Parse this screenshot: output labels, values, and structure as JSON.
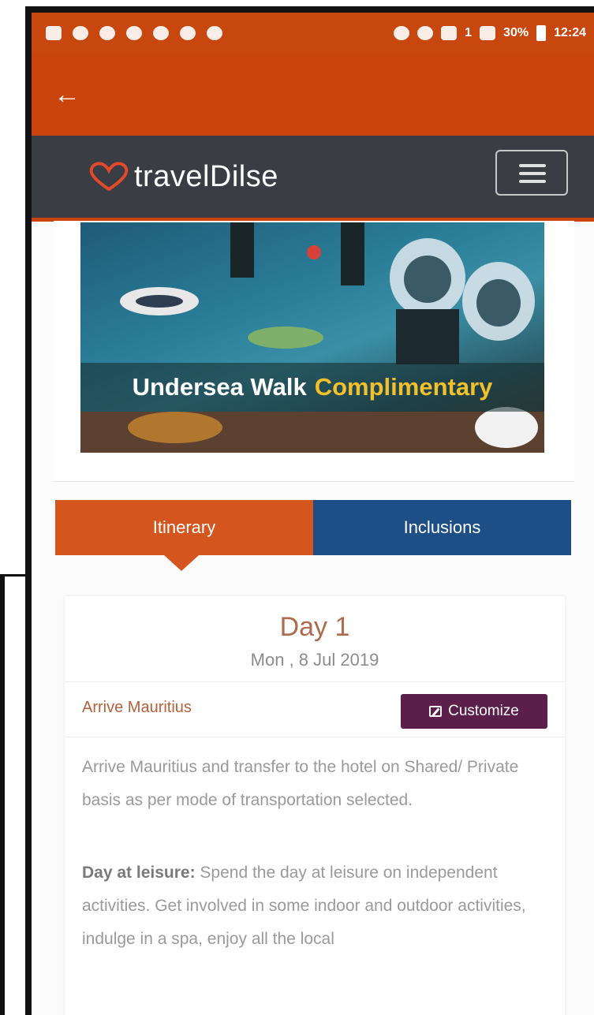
{
  "status_bar": {
    "network_label": "1",
    "battery_percent": "30%",
    "time": "12:24"
  },
  "app_bar": {
    "back_icon": "arrow-left-icon"
  },
  "nav": {
    "brand_name": "travelDilse",
    "menu_icon": "hamburger-menu-icon"
  },
  "banner": {
    "caption_main": "Undersea Walk",
    "caption_highlight": "Complimentary"
  },
  "tabs": [
    {
      "label": "Itinerary",
      "active": true
    },
    {
      "label": "Inclusions",
      "active": false
    }
  ],
  "day": {
    "title": "Day 1",
    "date": "Mon , 8 Jul 2019",
    "activity_title": "Arrive Mauritius",
    "customize_label": "Customize",
    "description_1": "Arrive Mauritius and transfer to the hotel on Shared/ Private basis as per mode of transportation selected.",
    "leisure_label": "Day at leisure:",
    "description_2": " Spend the day at leisure on independent activities. Get involved in some indoor and outdoor activities, indulge in a spa, enjoy all the local"
  },
  "colors": {
    "header_orange": "#c9450d",
    "nav_dark": "#3a3d43",
    "tab_active": "#d4561e",
    "tab_inactive": "#1d4e86",
    "customize_purple": "#5c1f4b"
  }
}
